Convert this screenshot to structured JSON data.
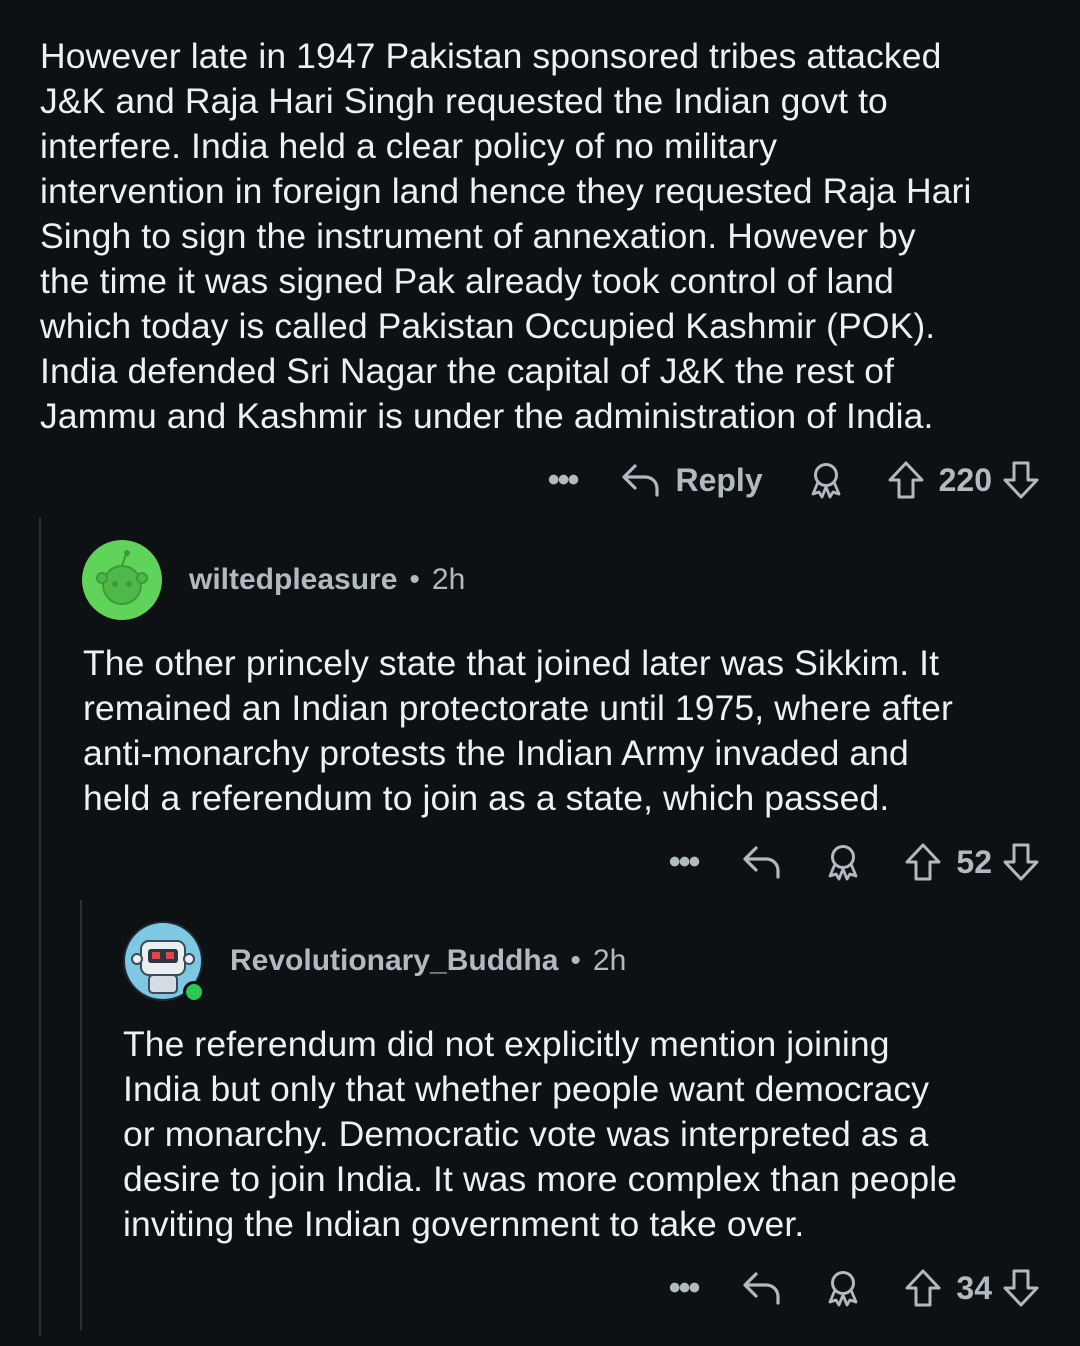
{
  "comments": [
    {
      "body": "However late in 1947 Pakistan sponsored tribes attacked\nJ&K and Raja Hari Singh requested the Indian govt to\ninterfere. India held a clear policy of no military\nintervention in foreign land hence they requested Raja Hari\nSingh to sign the instrument of annexation. However by\nthe time it was signed Pak already took control of land\nwhich today is called Pakistan Occupied Kashmir (POK).\nIndia defended Sri Nagar the capital of J&K the rest of\nJammu and Kashmir is under the administration of India.",
      "actions": {
        "more": "•••",
        "reply_label": "Reply",
        "score": "220"
      }
    },
    {
      "username": "wiltedpleasure",
      "separator": "•",
      "time": "2h",
      "avatar_color": "#5fd35a",
      "body": "The other princely state that joined later was Sikkim. It\nremained an Indian protectorate until 1975, where after\nanti-monarchy protests the Indian Army invaded and\nheld a referendum to join as a state, which passed.",
      "actions": {
        "more": "•••",
        "score": "52"
      }
    },
    {
      "username": "Revolutionary_Buddha",
      "separator": "•",
      "time": "2h",
      "avatar_color": "#7ec8e3",
      "online_color": "#2dc653",
      "body": "The referendum did not explicitly mention joining\nIndia but only that whether people want democracy\nor monarchy. Democratic vote was interpreted as a\ndesire to join India. It was more complex than people\ninviting the Indian government to take over.",
      "actions": {
        "more": "•••",
        "score": "34"
      }
    }
  ]
}
